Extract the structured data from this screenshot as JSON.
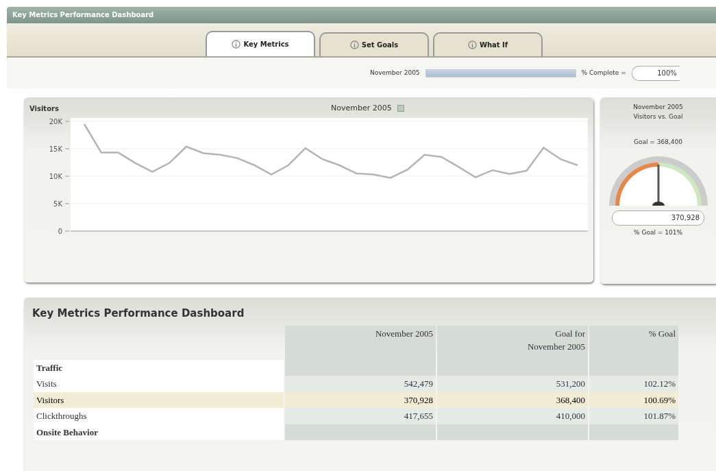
{
  "window": {
    "title": "Key Metrics Performance Dashboard"
  },
  "tabs": [
    {
      "label": "Key Metrics",
      "selected": true
    },
    {
      "label": "Set Goals",
      "selected": false
    },
    {
      "label": "What If",
      "selected": false
    }
  ],
  "progress": {
    "label": "November 2005",
    "level": 1.0,
    "complete_label": "% Complete =",
    "complete_value": "100%"
  },
  "visitors_chart": {
    "title": "Visitors",
    "chart_data": {
      "type": "line",
      "grid": true,
      "ylim": [
        0,
        20000
      ],
      "yticks": [
        {
          "value": 0,
          "label": "0"
        },
        {
          "value": 5000,
          "label": "5K"
        },
        {
          "value": 10000,
          "label": "10K"
        },
        {
          "value": 15000,
          "label": "15K"
        },
        {
          "value": 20000,
          "label": "20K"
        }
      ],
      "series": [
        {
          "name": "November 2005",
          "color": "#b4b4b4",
          "values": [
            19500,
            14300,
            14300,
            12400,
            10800,
            12400,
            15400,
            14200,
            13900,
            13300,
            12000,
            10300,
            12000,
            15100,
            13100,
            12000,
            10500,
            10300,
            9700,
            11200,
            13900,
            13500,
            11700,
            9800,
            11100,
            10400,
            11000,
            15200,
            13100,
            12000
          ]
        }
      ]
    }
  },
  "gauge": {
    "title": "November 2005",
    "subtitle": "Visitors vs. Goal",
    "goal": "Goal = 368,400",
    "level": 0.5,
    "value": "370,928",
    "percent": "% Goal = 101%"
  },
  "table": {
    "title": "Key Metrics Performance Dashboard",
    "columns": [
      "November 2005",
      "Goal for November 2005",
      "% Goal"
    ],
    "rows": [
      {
        "kind": "section",
        "label": "Traffic"
      },
      {
        "kind": "data",
        "label": "Visits",
        "values": [
          "542,479",
          "531,200",
          "102.12%"
        ],
        "highlighted": false
      },
      {
        "kind": "data",
        "label": "Visitors",
        "values": [
          "370,928",
          "368,400",
          "100.69%"
        ],
        "highlighted": true
      },
      {
        "kind": "data",
        "label": "Clickthroughs",
        "values": [
          "417,655",
          "410,000",
          "101.87%"
        ],
        "highlighted": false
      },
      {
        "kind": "section",
        "label": "Onsite Behavior"
      }
    ]
  }
}
